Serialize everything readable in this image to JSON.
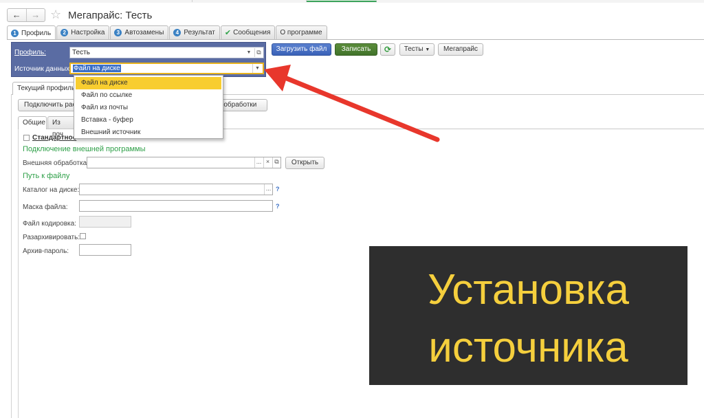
{
  "window": {
    "title": "Мегапрайс: Тесть",
    "back_icon": "arrow-left-icon",
    "forward_icon": "arrow-right-icon",
    "favorite_icon": "star-icon"
  },
  "tabs": [
    {
      "number": "1",
      "label": "Профиль"
    },
    {
      "number": "2",
      "label": "Настройка"
    },
    {
      "number": "3",
      "label": "Автозамены"
    },
    {
      "number": "4",
      "label": "Результат"
    },
    {
      "number": "",
      "label": "Сообщения",
      "icon": "check-icon"
    },
    {
      "number": "",
      "label": "О программе"
    }
  ],
  "profile": {
    "profile_label": "Профиль:",
    "profile_value": "Тесть",
    "source_label": "Источник данных:",
    "source_value": "Файл на диске"
  },
  "toolbar": {
    "load_file": "Загрузить файл",
    "save": "Записать",
    "refresh_icon": "refresh-icon",
    "tests": "Тесты",
    "megaprice": "Мегапрайс"
  },
  "dropdown": {
    "options": [
      "Файл на диске",
      "Файл по ссылке",
      "Файл из почты",
      "Вставка - буфер",
      "Внешний источник"
    ],
    "selected": "Файл на диске"
  },
  "current_profile": {
    "tab_label": "Текущий профиль",
    "connect_button": "Подключить рас",
    "processing_button": "е обработки",
    "subtabs": [
      "Общие",
      "Из поч"
    ],
    "standard_checkbox": "Стандартное"
  },
  "external": {
    "heading": "Подключение внешней программы",
    "processing_label": "Внешняя обработка:",
    "open_button": "Открыть"
  },
  "file_path": {
    "heading": "Путь к файлу",
    "catalog_label": "Каталог на диске:",
    "mask_label": "Маска файла:",
    "encoding_label": "Файл кодировка:",
    "unzip_label": "Разархивировать:",
    "archive_password_label": "Архив-пароль:",
    "help_mark": "?"
  },
  "banner": {
    "line1": "Установка",
    "line2": "источника"
  },
  "colors": {
    "accent_yellow": "#f5cf3d",
    "profile_panel": "#5a6ca3",
    "arrow": "#e8372c",
    "group_heading": "#2d9f47"
  }
}
